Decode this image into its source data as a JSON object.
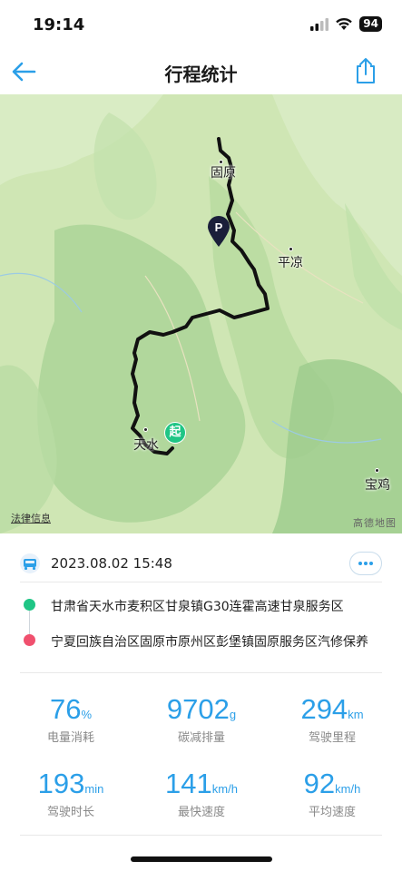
{
  "status_bar": {
    "time": "19:14",
    "battery": "94",
    "icons": [
      "signal-icon",
      "wifi-icon",
      "battery-icon"
    ]
  },
  "nav": {
    "title": "行程统计",
    "back_icon": "arrow-left-icon",
    "share_icon": "share-icon"
  },
  "map": {
    "cities": {
      "guyuan": "固原",
      "pingliang": "平凉",
      "tianshui": "天水",
      "baoji": "宝鸡"
    },
    "start_marker": "起",
    "end_marker": "P",
    "legal_link": "法律信息",
    "provider": "高德地图"
  },
  "trip": {
    "datetime": "2023.08.02 15:48",
    "start_location": "甘肃省天水市麦积区甘泉镇G30连霍高速甘泉服务区",
    "end_location": "宁夏回族自治区固原市原州区彭堡镇固原服务区汽修保养"
  },
  "stats": [
    {
      "value": "76",
      "unit": "%",
      "label": "电量消耗"
    },
    {
      "value": "9702",
      "unit": "g",
      "label": "碳减排量"
    },
    {
      "value": "294",
      "unit": "km",
      "label": "驾驶里程"
    },
    {
      "value": "193",
      "unit": "min",
      "label": "驾驶时长"
    },
    {
      "value": "141",
      "unit": "km/h",
      "label": "最快速度"
    },
    {
      "value": "92",
      "unit": "km/h",
      "label": "平均速度"
    }
  ],
  "colors": {
    "accent": "#2b9fe8",
    "start_dot": "#1fc585",
    "end_dot": "#f0506e",
    "route": "#111111"
  }
}
